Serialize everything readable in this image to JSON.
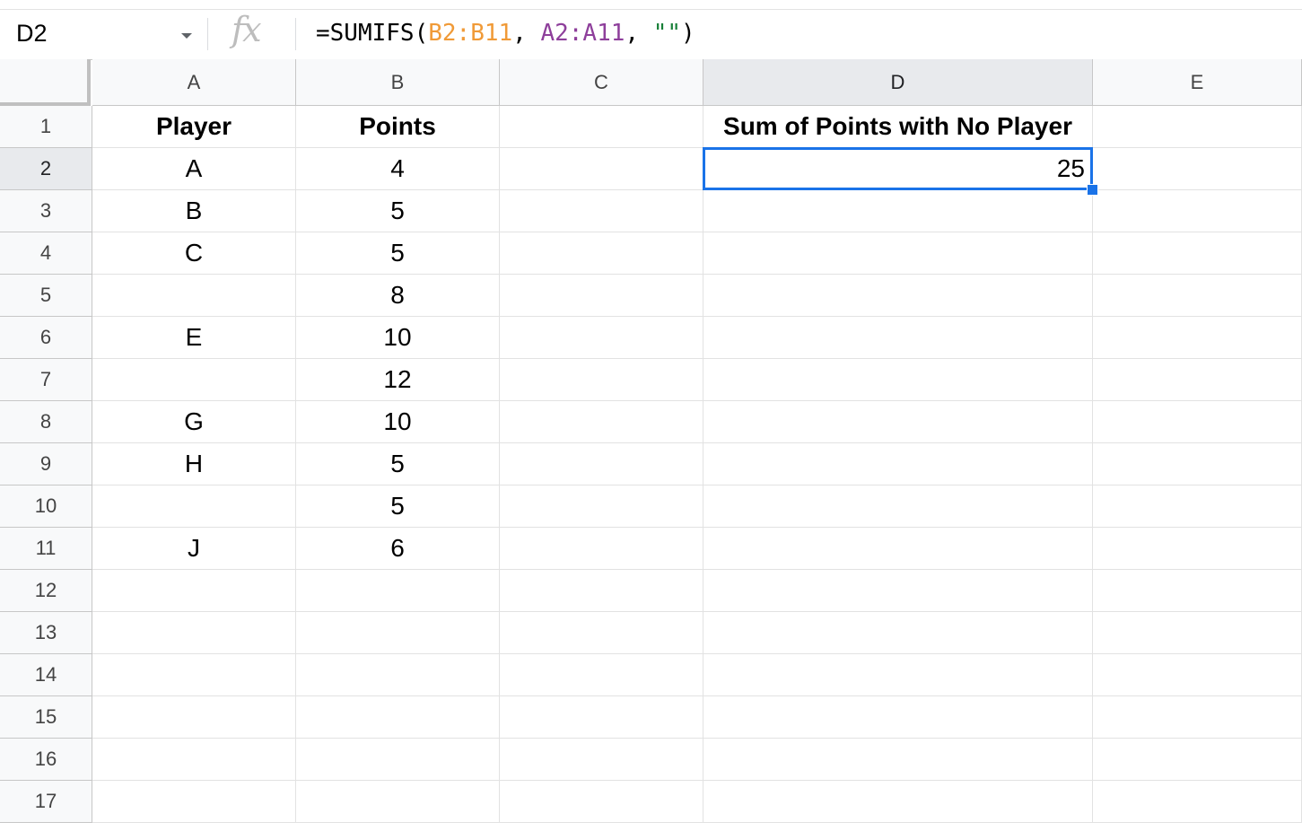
{
  "formula_bar": {
    "name_box": "D2",
    "fx_icon": "function-icon",
    "formula_parts": [
      {
        "text": "=SUMIFS(",
        "color": "#000000"
      },
      {
        "text": "B2:B11",
        "color": "#f09a37"
      },
      {
        "text": ", ",
        "color": "#000000"
      },
      {
        "text": "A2:A11",
        "color": "#8e3f9b"
      },
      {
        "text": ", ",
        "color": "#000000"
      },
      {
        "text": "\"\"",
        "color": "#188038"
      },
      {
        "text": ")",
        "color": "#000000"
      }
    ]
  },
  "columns": [
    "A",
    "B",
    "C",
    "D",
    "E"
  ],
  "selected_column": "D",
  "rows": [
    "1",
    "2",
    "3",
    "4",
    "5",
    "6",
    "7",
    "8",
    "9",
    "10",
    "11",
    "12",
    "13",
    "14",
    "15",
    "16",
    "17"
  ],
  "selected_row": "2",
  "selected_cell": "D2",
  "selection_color": "#1a73e8",
  "cells": {
    "A1": "Player",
    "B1": "Points",
    "D1": "Sum of Points with No Player",
    "A2": "A",
    "B2": "4",
    "D2": "25",
    "A3": "B",
    "B3": "5",
    "A4": "C",
    "B4": "5",
    "A5": "",
    "B5": "8",
    "A6": "E",
    "B6": "10",
    "A7": "",
    "B7": "12",
    "A8": "G",
    "B8": "10",
    "A9": "H",
    "B9": "5",
    "A10": "",
    "B10": "5",
    "A11": "J",
    "B11": "6"
  }
}
